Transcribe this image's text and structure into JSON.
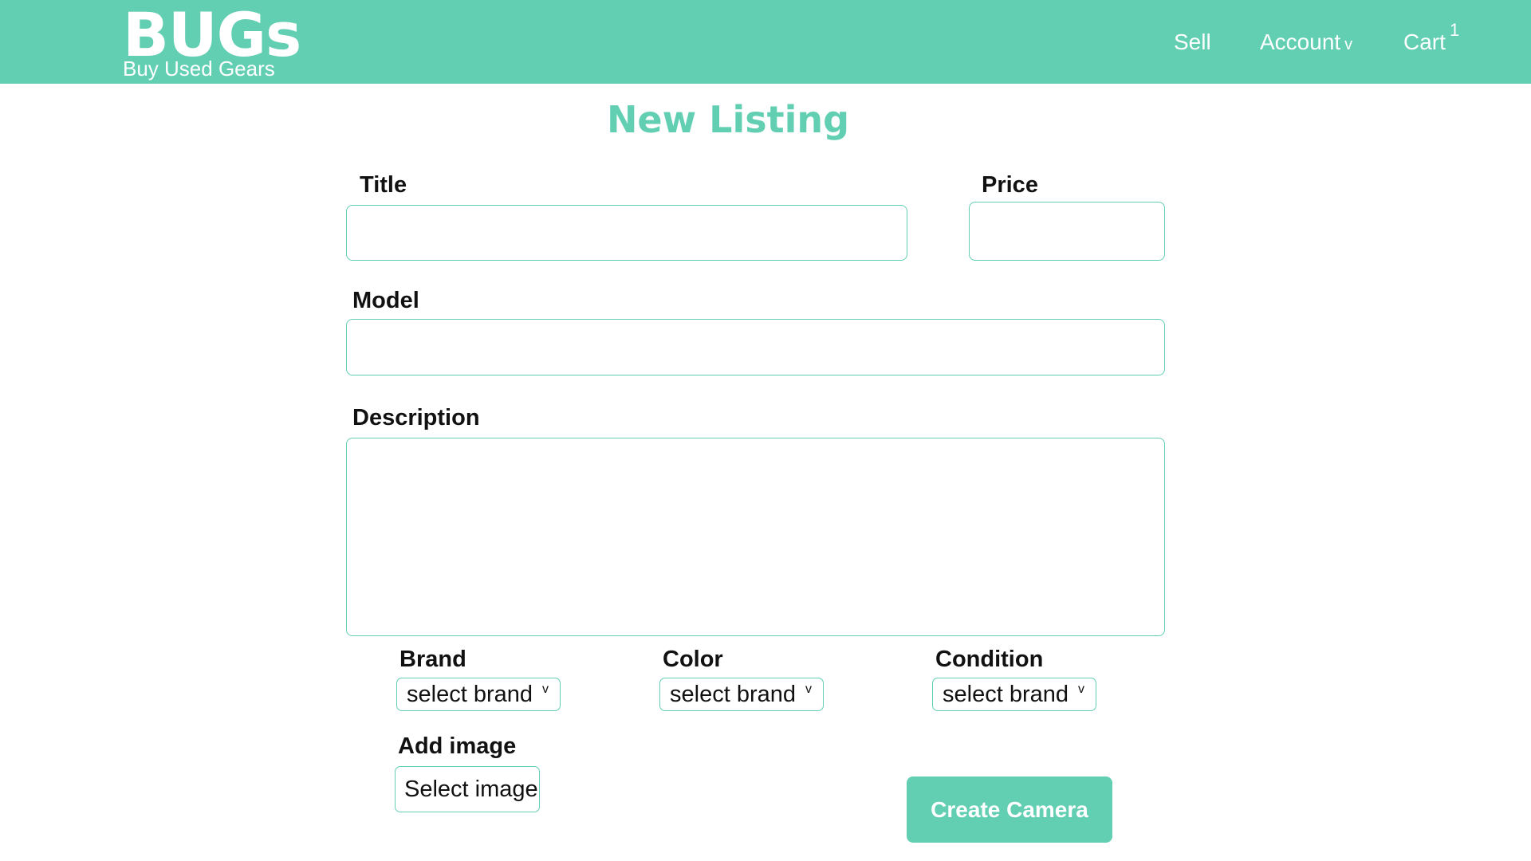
{
  "brand": {
    "name": "BUGs",
    "tagline": "Buy Used Gears"
  },
  "nav": {
    "sell": "Sell",
    "account": "Account",
    "account_caret": "v",
    "cart": "Cart",
    "cart_count": "1"
  },
  "form": {
    "heading": "New Listing",
    "title_label": "Title",
    "title_value": "",
    "price_label": "Price",
    "price_value": "",
    "model_label": "Model",
    "model_value": "",
    "description_label": "Description",
    "description_value": "",
    "brand_label": "Brand",
    "brand_selected": "select brand",
    "color_label": "Color",
    "color_selected": "select brand",
    "condition_label": "Condition",
    "condition_selected": "select brand",
    "select_caret": "v",
    "image_label": "Add image",
    "image_button": "Select image",
    "submit_label": "Create Camera"
  },
  "colors": {
    "accent": "#62cfb3",
    "background": "#ffffff",
    "text": "#111111"
  },
  "icons": {
    "dropdown": "chevron-down-icon"
  }
}
